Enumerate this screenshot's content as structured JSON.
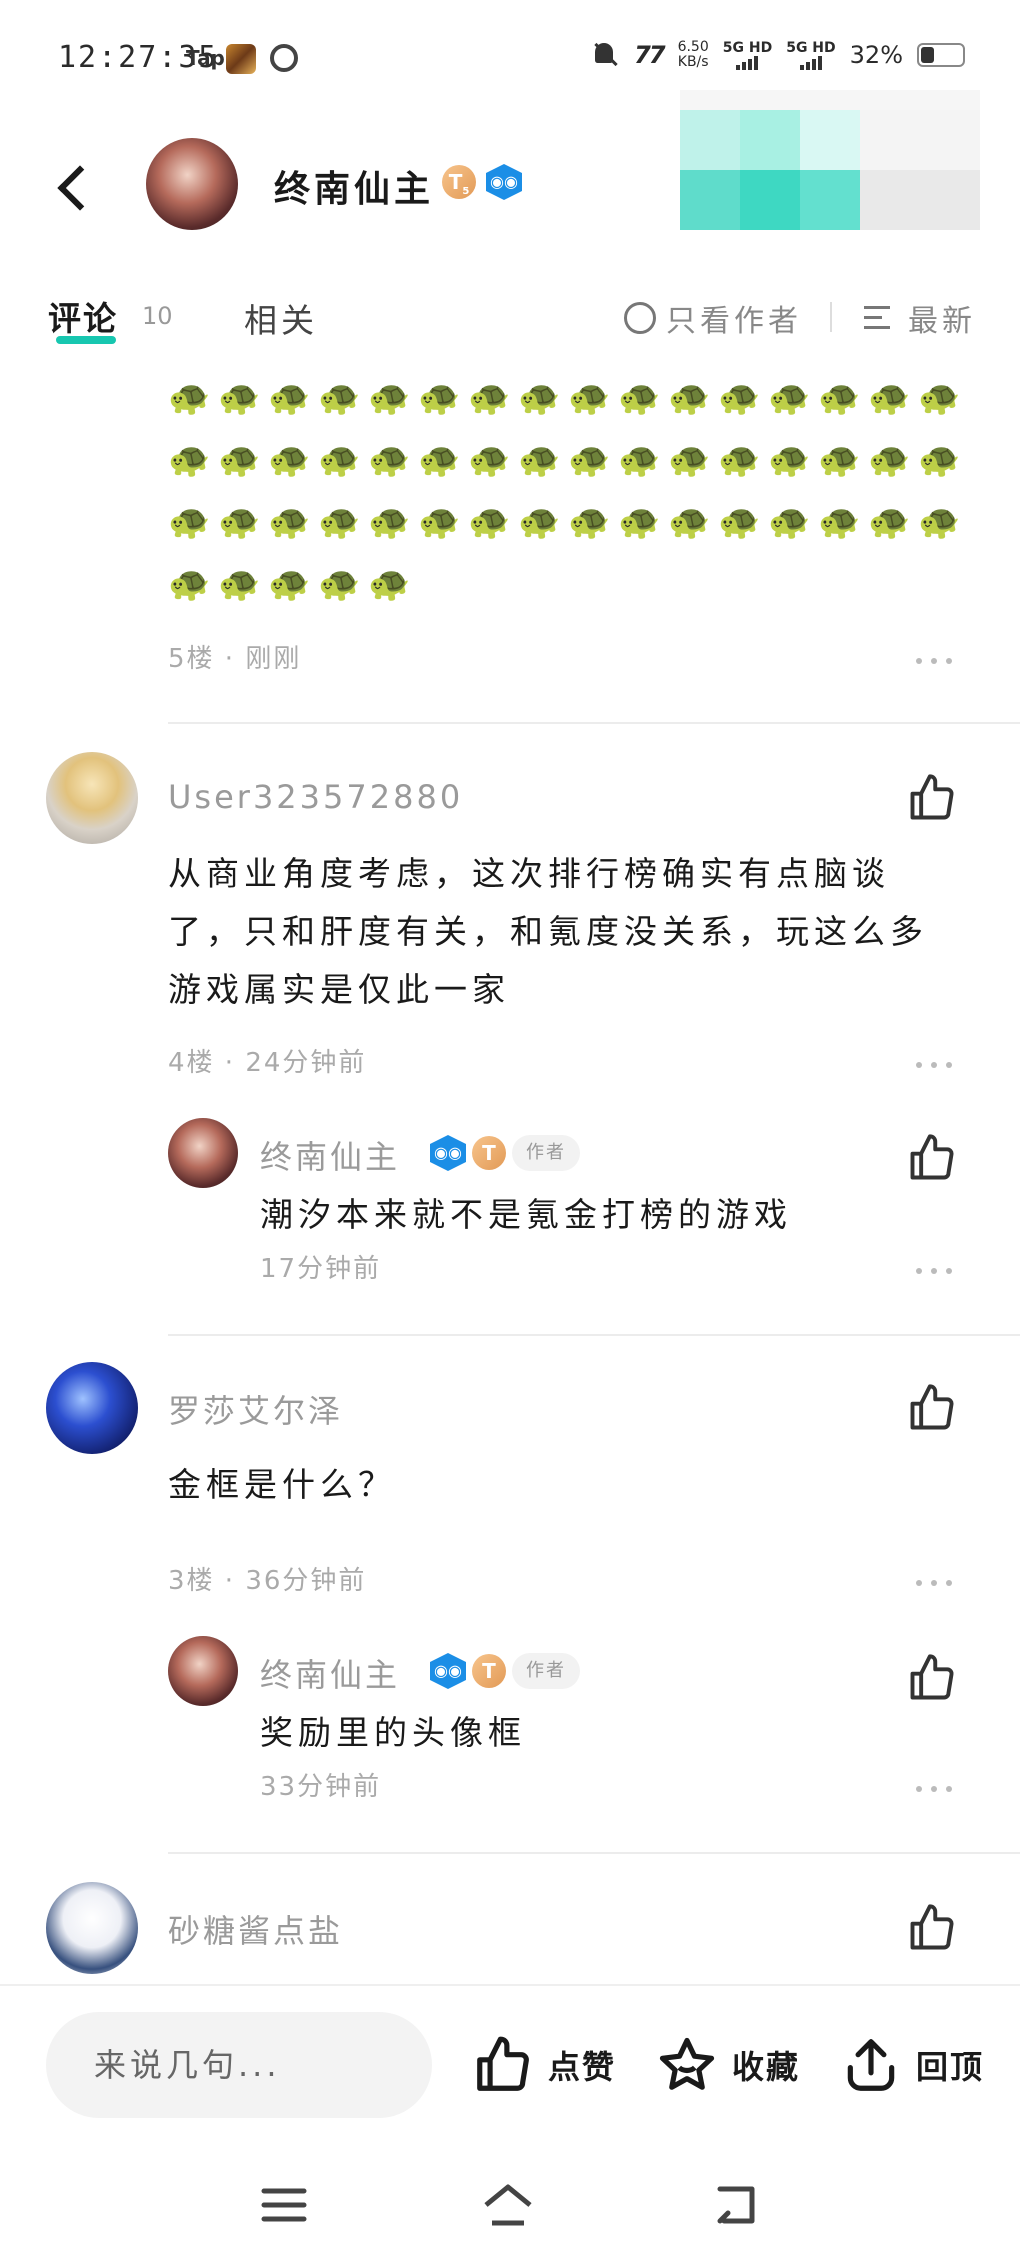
{
  "status_bar": {
    "time": "12:27:35",
    "app_tap": "Tap",
    "net_speed_value": "6.50",
    "net_speed_unit": "KB/s",
    "signal_1": "5G HD",
    "signal_2": "5G HD",
    "battery_percent": "32%"
  },
  "header": {
    "author_name": "终南仙主",
    "level_badge": "T",
    "level_sub": "5"
  },
  "tabs": {
    "comments_label": "评论",
    "comments_count": "10",
    "related_label": "相关",
    "author_only_label": "只看作者",
    "sort_label": "最新"
  },
  "comments": [
    {
      "floor_meta": "5楼 · 刚刚",
      "turtle_count": 53
    },
    {
      "user": "User323572880",
      "text_line1": "从商业角度考虑，这次排行榜确实有点脑谈",
      "text_line2": "了，只和肝度有关，和氪度没关系，玩这么多",
      "text_line3": "游戏属实是仅此一家",
      "meta": "4楼 · 24分钟前",
      "reply": {
        "user": "终南仙主",
        "tag": "作者",
        "text": "潮汐本来就不是氪金打榜的游戏",
        "time": "17分钟前"
      }
    },
    {
      "user": "罗莎艾尔泽",
      "text": "金框是什么？",
      "meta": "3楼 · 36分钟前",
      "reply": {
        "user": "终南仙主",
        "tag": "作者",
        "text": "奖励里的头像框",
        "time": "33分钟前"
      }
    },
    {
      "user": "砂糖酱点盐"
    }
  ],
  "bottom_bar": {
    "input_placeholder": "来说几句...",
    "like_label": "点赞",
    "favorite_label": "收藏",
    "top_label": "回顶"
  },
  "colors": {
    "accent": "#17c7b0",
    "badge_blue": "#1b8ee6",
    "badge_orange": "#e29a56",
    "muted_text": "#9a9a9a"
  }
}
